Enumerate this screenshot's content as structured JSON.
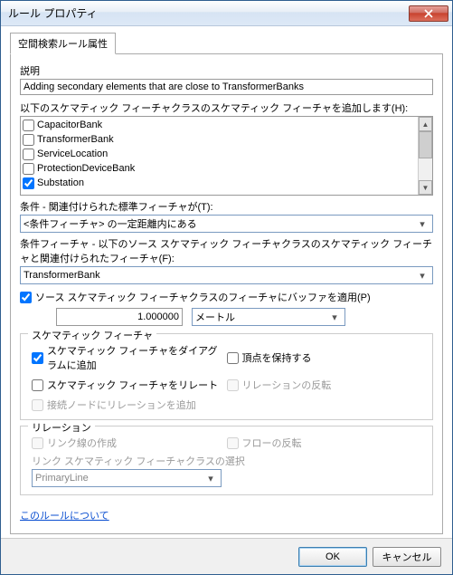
{
  "title": "ルール プロパティ",
  "tab": "空間検索ルール属性",
  "desc_label": "説明",
  "desc_value": "Adding secondary elements that are close to TransformerBanks",
  "list_label": "以下のスケマティック フィーチャクラスのスケマティック フィーチャを追加します(H):",
  "list_items": [
    "CapacitorBank",
    "TransformerBank",
    "ServiceLocation",
    "ProtectionDeviceBank",
    "Substation"
  ],
  "cond_label": "条件 - 関連付けられた標準フィーチャが(T):",
  "cond_value": "<条件フィーチャ> の一定距離内にある",
  "cond_feat_label": "条件フィーチャ - 以下のソース スケマティック フィーチャクラスのスケマティック フィーチャと関連付けられたフィーチャ(F):",
  "cond_feat_value": "TransformerBank",
  "buffer_check": "ソース スケマティック フィーチャクラスのフィーチャにバッファを適用(P)",
  "buffer_value": "1.000000",
  "buffer_unit": "メートル",
  "group1_legend": "スケマティック フィーチャ",
  "g1_add_diagram": "スケマティック フィーチャをダイアグラムに追加",
  "g1_keep_vertex": "頂点を保持する",
  "g1_relate": "スケマティック フィーチャをリレート",
  "g1_relation_rev": "リレーションの反転",
  "g1_add_rel_conn": "接続ノードにリレーションを追加",
  "group2_legend": "リレーション",
  "g2_link_create": "リンク線の作成",
  "g2_flow_rev": "フローの反転",
  "g2_link_class_label": "リンク スケマティック フィーチャクラスの選択",
  "g2_link_class_value": "PrimaryLine",
  "link_text": "このルールについて",
  "btn_ok": "OK",
  "btn_cancel": "キャンセル"
}
